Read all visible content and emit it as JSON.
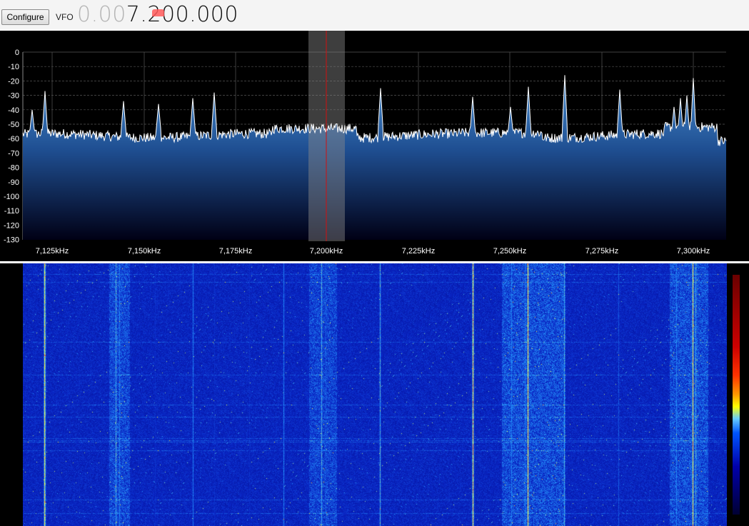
{
  "toolbar": {
    "configure_label": "Configure",
    "vfo_label": "VFO",
    "vfo_dim": "0.00",
    "vfo_bright": "7.200.000"
  },
  "spectrum": {
    "y_ticks": [
      "0",
      "-10",
      "-20",
      "-30",
      "-40",
      "-50",
      "-60",
      "-70",
      "-80",
      "-90",
      "-100",
      "-110",
      "-120",
      "-130"
    ],
    "x_ticks": [
      "7,125kHz",
      "7,150kHz",
      "7,175kHz",
      "7,200kHz",
      "7,225kHz",
      "7,250kHz",
      "7,275kHz",
      "7,300kHz"
    ],
    "tuned_frequency_khz": 7200,
    "colors": {
      "background": "#000000",
      "grid": "#555555",
      "trace": "#ffffff",
      "fill_top": "#4a8fd0",
      "fill_bottom": "#000015",
      "tuning_line": "#d01010",
      "passband": "#8a8a8a"
    }
  },
  "waterfall": {
    "colors": {
      "low": "#00008f",
      "mid": "#2a8cff",
      "high": "#ffff40",
      "peak": "#ff3010"
    }
  }
}
